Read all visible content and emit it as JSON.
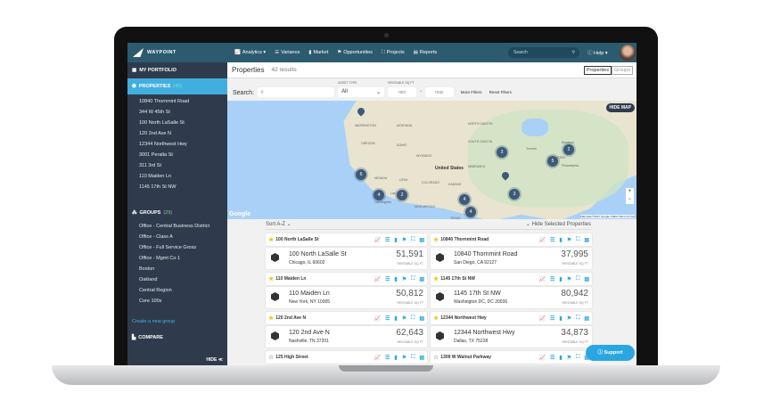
{
  "header": {
    "brand": "WAYPOINT",
    "nav": [
      "Analytics ▾",
      "Variance",
      "Market",
      "Opportunities",
      "Projects",
      "Reports"
    ],
    "search_placeholder": "Search",
    "help": "Help ▾"
  },
  "sidebar": {
    "portfolio": "MY PORTFOLIO",
    "properties": "PROPERTIES",
    "properties_count": "(42)",
    "property_items": [
      "10840 Thornmint Road",
      "344 W 45th St",
      "100 North LaSalle St",
      "120 2nd Ave N",
      "12344 Northwest Hwy",
      "3001 Peralta St",
      "311 3rd St",
      "110 Maiden Ln",
      "1145 17th St NW"
    ],
    "groups": "GROUPS",
    "groups_count": "(29)",
    "group_items": [
      "Office - Central Business District",
      "Office - Class A",
      "Office - Full Service Gross",
      "Office - Mgmt Co 1",
      "Boston",
      "Oakland",
      "Central Region",
      "Core 100s"
    ],
    "create_group": "Create a new group",
    "compare": "COMPARE",
    "hide": "HIDE ≪"
  },
  "main": {
    "title": "Properties",
    "results": "42 results",
    "toggle": [
      "Properties",
      "Groups"
    ],
    "search_label": "Search:",
    "asset_type_label": "ASSET TYPE",
    "asset_type_value": "All",
    "rsf_label": "RENTABLE SQ FT",
    "min_placeholder": "min",
    "max_placeholder": "max",
    "more_filters": "More Filters",
    "reset_filters": "Reset Filters"
  },
  "map": {
    "hide": "HIDE MAP",
    "zoom_in": "+",
    "zoom_out": "−",
    "google": "Google",
    "attribution": "Map data ©2017 Google, INEGI  Terms of Use",
    "labels": [
      "WASHINGTON",
      "MONTANA",
      "NORTH DAKOTA",
      "OREGON",
      "IDAHO",
      "SOUTH DAKOTA",
      "WYOMING",
      "NEBRASKA",
      "United States",
      "NEVADA",
      "UTAH",
      "COLORADO",
      "KANSAS",
      "NEW MEXICO",
      "TEXAS",
      "Las Vegas",
      "Los Angeles",
      "Philadelphia",
      "NEW YORK",
      "Toronto",
      "Montreal"
    ],
    "clusters": [
      "6",
      "4",
      "2",
      "4",
      "4",
      "3",
      "2",
      "5",
      "3"
    ]
  },
  "list": {
    "sort": "Sort A-Z ⌄",
    "hide_selected": "⌄ Hide Selected Properties",
    "rsf": "RENTABLE SQ FT",
    "cards": [
      {
        "name": "100 North LaSalle St",
        "addr": "100 North LaSalle St",
        "city": "Chicago, IL 60602",
        "sqft": "51,591",
        "starred": true
      },
      {
        "name": "10840 Thornmint Road",
        "addr": "10840 Thornmint Road",
        "city": "San Diego, CA 92127",
        "sqft": "37,995",
        "starred": true
      },
      {
        "name": "110 Maiden Ln",
        "addr": "110 Maiden Ln",
        "city": "New York, NY 10005",
        "sqft": "50,812",
        "starred": true
      },
      {
        "name": "1145 17th St NW",
        "addr": "1145 17th St NW",
        "city": "Washington DC, DC 20036",
        "sqft": "80,942",
        "starred": true
      },
      {
        "name": "120 2nd Ave N",
        "addr": "120 2nd Ave N",
        "city": "Nashville, TN 37201",
        "sqft": "62,643",
        "starred": true
      },
      {
        "name": "12344 Northwest Hwy",
        "addr": "12344 Northwest Hwy",
        "city": "Dallas, TX 75228",
        "sqft": "34,873",
        "starred": true
      },
      {
        "name": "125 High Street",
        "starred": false
      },
      {
        "name": "1309 W Walnut Parkway",
        "starred": false
      }
    ]
  },
  "support": "Support"
}
